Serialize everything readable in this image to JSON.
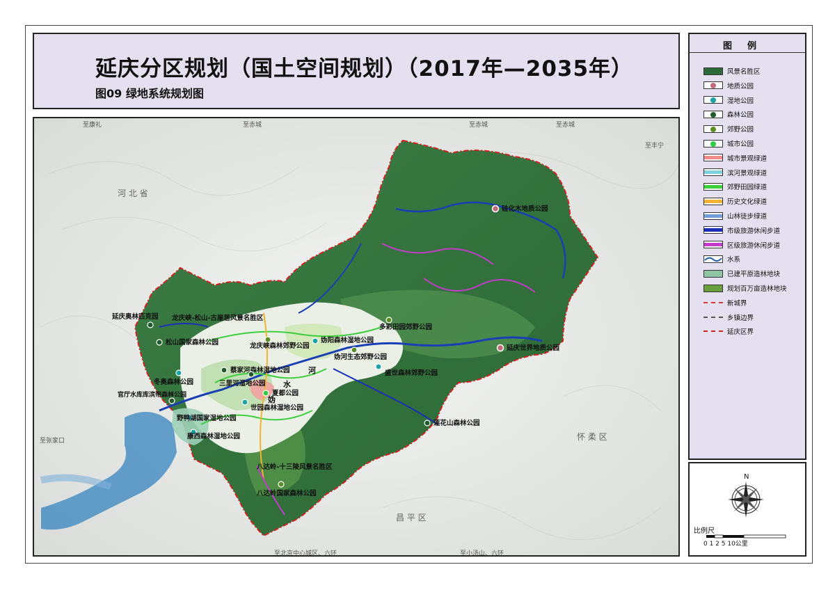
{
  "header": {
    "main_title": "延庆分区规划（国土空间规划）（2017年—2035年）",
    "sub_title": "图09  绿地系统规划图"
  },
  "legend": {
    "title": "图例",
    "items": [
      {
        "label": "风景名胜区",
        "kind": "fill",
        "color": "#2f6b3a"
      },
      {
        "label": "地质公园",
        "kind": "dot",
        "color": "#c36a7a"
      },
      {
        "label": "湿地公园",
        "kind": "dot",
        "color": "#1aa3a3"
      },
      {
        "label": "森林公园",
        "kind": "dot",
        "color": "#1e5a2a"
      },
      {
        "label": "郊野公园",
        "kind": "dot",
        "color": "#5b8f22"
      },
      {
        "label": "城市公园",
        "kind": "dot",
        "color": "#2ecc40"
      },
      {
        "label": "城市景观绿道",
        "kind": "line",
        "color": "#f28b8b"
      },
      {
        "label": "滨河景观绿道",
        "kind": "line",
        "color": "#7fd1dc"
      },
      {
        "label": "郊野田园绿道",
        "kind": "line",
        "color": "#3ccf3c"
      },
      {
        "label": "历史文化绿道",
        "kind": "line",
        "color": "#f2b233"
      },
      {
        "label": "山林徒步绿道",
        "kind": "line",
        "color": "#6e9fd6"
      },
      {
        "label": "市级旅游休闲步道",
        "kind": "line",
        "color": "#1a2fb5"
      },
      {
        "label": "区级旅游休闲步道",
        "kind": "line",
        "color": "#c33cc9"
      },
      {
        "label": "水系",
        "kind": "water",
        "color": "#2a5fa8"
      },
      {
        "label": "已建平原造林地块",
        "kind": "fill",
        "color": "#8fc4a4"
      },
      {
        "label": "规划百万亩造林地块",
        "kind": "fill",
        "color": "#6a9e3f"
      },
      {
        "label": "新城界",
        "kind": "dash",
        "color": "#d43a3a"
      },
      {
        "label": "乡镇边界",
        "kind": "dash",
        "color": "#555555"
      },
      {
        "label": "延庆区界",
        "kind": "dashdot",
        "color": "#d42020"
      }
    ]
  },
  "compass": {
    "north_label": "N",
    "scale_label": "比例尺",
    "scale_ticks": "0 1 2     5          10公里"
  },
  "map": {
    "region_labels": [
      "河 北 省",
      "怀 柔 区",
      "昌 平 区"
    ],
    "road_labels": [
      "至康礼",
      "至赤城",
      "至赤城",
      "至赤城",
      "至丰宁",
      "至张家口",
      "至北京中心城区、六环",
      "至小汤山、六环"
    ],
    "parks": [
      {
        "name": "硅化木地质公园",
        "type": "geo"
      },
      {
        "name": "延庆世界地质公园",
        "type": "geo"
      },
      {
        "name": "多彩田园郊野公园",
        "type": "suburban"
      },
      {
        "name": "延庆奥林匹克园",
        "type": "forest"
      },
      {
        "name": "龙庆峡-松山-古崖居风景名胜区",
        "type": "scenic"
      },
      {
        "name": "松山国家森林公园",
        "type": "forest"
      },
      {
        "name": "龙庆峡森林郊野公园",
        "type": "suburban"
      },
      {
        "name": "妫阳森林湿地公园",
        "type": "wetland"
      },
      {
        "name": "妫河生态郊野公园",
        "type": "suburban"
      },
      {
        "name": "蔡家河森林湿地公园",
        "type": "forest"
      },
      {
        "name": "盛世森林郊野公园",
        "type": "wetland"
      },
      {
        "name": "冬奥森林公园",
        "type": "wetland"
      },
      {
        "name": "三里河湿地公园",
        "type": "forest"
      },
      {
        "name": "官厅水库库滨带森林公园",
        "type": "forest"
      },
      {
        "name": "夏都公园",
        "type": "city"
      },
      {
        "name": "世园森林湿地公园",
        "type": "wetland"
      },
      {
        "name": "野鸭湖国家湿地公园",
        "type": "wetland"
      },
      {
        "name": "莲花山森林公园",
        "type": "forest"
      },
      {
        "name": "康西森林湿地公园",
        "type": "wetland"
      },
      {
        "name": "八达岭-十三陵风景名胜区",
        "type": "scenic"
      },
      {
        "name": "八达岭国家森林公园",
        "type": "suburban"
      }
    ],
    "water_labels": [
      "妫",
      "水",
      "河"
    ]
  }
}
